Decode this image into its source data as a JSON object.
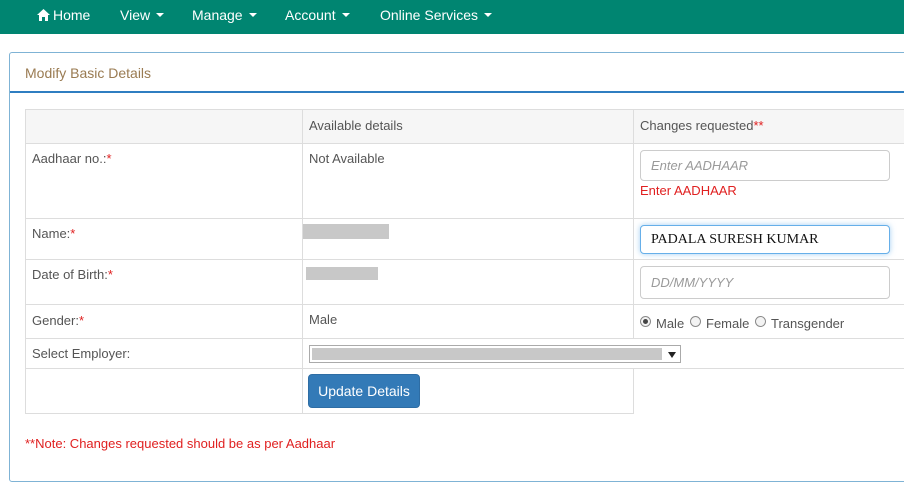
{
  "navbar": {
    "background": "#008571",
    "items": [
      {
        "label": "Home",
        "icon": "home-icon"
      },
      {
        "label": "View",
        "has_dropdown": true
      },
      {
        "label": "Manage",
        "has_dropdown": true
      },
      {
        "label": "Account",
        "has_dropdown": true
      },
      {
        "label": "Online Services",
        "has_dropdown": true
      }
    ]
  },
  "panel": {
    "title": "Modify Basic Details"
  },
  "table": {
    "headers": {
      "available": "Available details",
      "changes": "Changes requested",
      "changes_required_mark": "**"
    },
    "rows": {
      "aadhaar": {
        "label": "Aadhaar no.:",
        "required_mark": "*",
        "available": "Not Available",
        "input_placeholder": "Enter AADHAAR",
        "error": "Enter AADHAAR"
      },
      "name": {
        "label": "Name:",
        "required_mark": "*",
        "input_value": "PADALA SURESH KUMAR"
      },
      "dob": {
        "label": "Date of Birth:",
        "required_mark": "*",
        "input_placeholder": "DD/MM/YYYY"
      },
      "gender": {
        "label": "Gender:",
        "required_mark": "*",
        "available": "Male",
        "options": [
          {
            "label": "Male",
            "checked": true
          },
          {
            "label": "Female",
            "checked": false
          },
          {
            "label": "Transgender",
            "checked": false
          }
        ]
      },
      "employer": {
        "label": "Select Employer:"
      }
    }
  },
  "actions": {
    "update_label": "Update Details"
  },
  "note": "**Note: Changes requested should be as per Aadhaar",
  "colors": {
    "accent": "#337ab7",
    "error": "#e02020",
    "panel_title": "#9a7b52"
  }
}
